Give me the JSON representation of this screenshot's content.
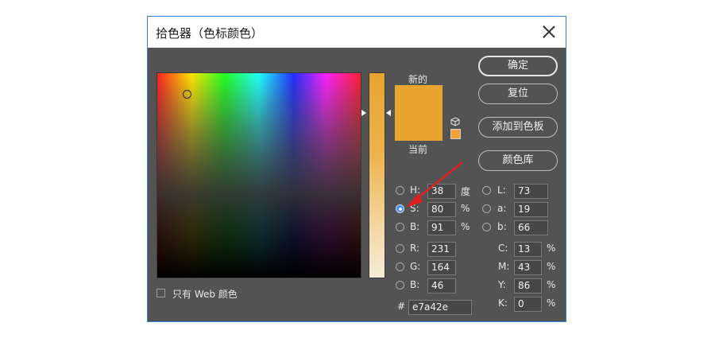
{
  "window": {
    "title": "拾色器（色标颜色）"
  },
  "colors": {
    "current": "#e7a42e",
    "new": "#e7a42e",
    "web_safe_swatch": "#f7a03a",
    "accent_arrow": "#e02020"
  },
  "swatch": {
    "new_label": "新的",
    "current_label": "当前"
  },
  "buttons": {
    "ok": "确定",
    "reset": "复位",
    "add_to_swatches": "添加到色板",
    "color_libraries": "颜色库"
  },
  "hsb": {
    "h": {
      "label": "H:",
      "value": "38",
      "unit": "度"
    },
    "s": {
      "label": "S:",
      "value": "80",
      "unit": "%"
    },
    "b": {
      "label": "B:",
      "value": "91",
      "unit": "%"
    }
  },
  "rgb": {
    "r": {
      "label": "R:",
      "value": "231"
    },
    "g": {
      "label": "G:",
      "value": "164"
    },
    "b": {
      "label": "B:",
      "value": "46"
    }
  },
  "lab": {
    "l": {
      "label": "L:",
      "value": "73"
    },
    "a": {
      "label": "a:",
      "value": "19"
    },
    "b": {
      "label": "b:",
      "value": "66"
    }
  },
  "cmyk": {
    "c": {
      "label": "C:",
      "value": "13",
      "unit": "%"
    },
    "m": {
      "label": "M:",
      "value": "43",
      "unit": "%"
    },
    "y": {
      "label": "Y:",
      "value": "86",
      "unit": "%"
    },
    "k": {
      "label": "K:",
      "value": "0",
      "unit": "%"
    }
  },
  "hex": {
    "label": "#",
    "value": "e7a42e"
  },
  "web_only": {
    "label": "只有 Web 颜色",
    "checked": false
  },
  "selected_mode": "S"
}
